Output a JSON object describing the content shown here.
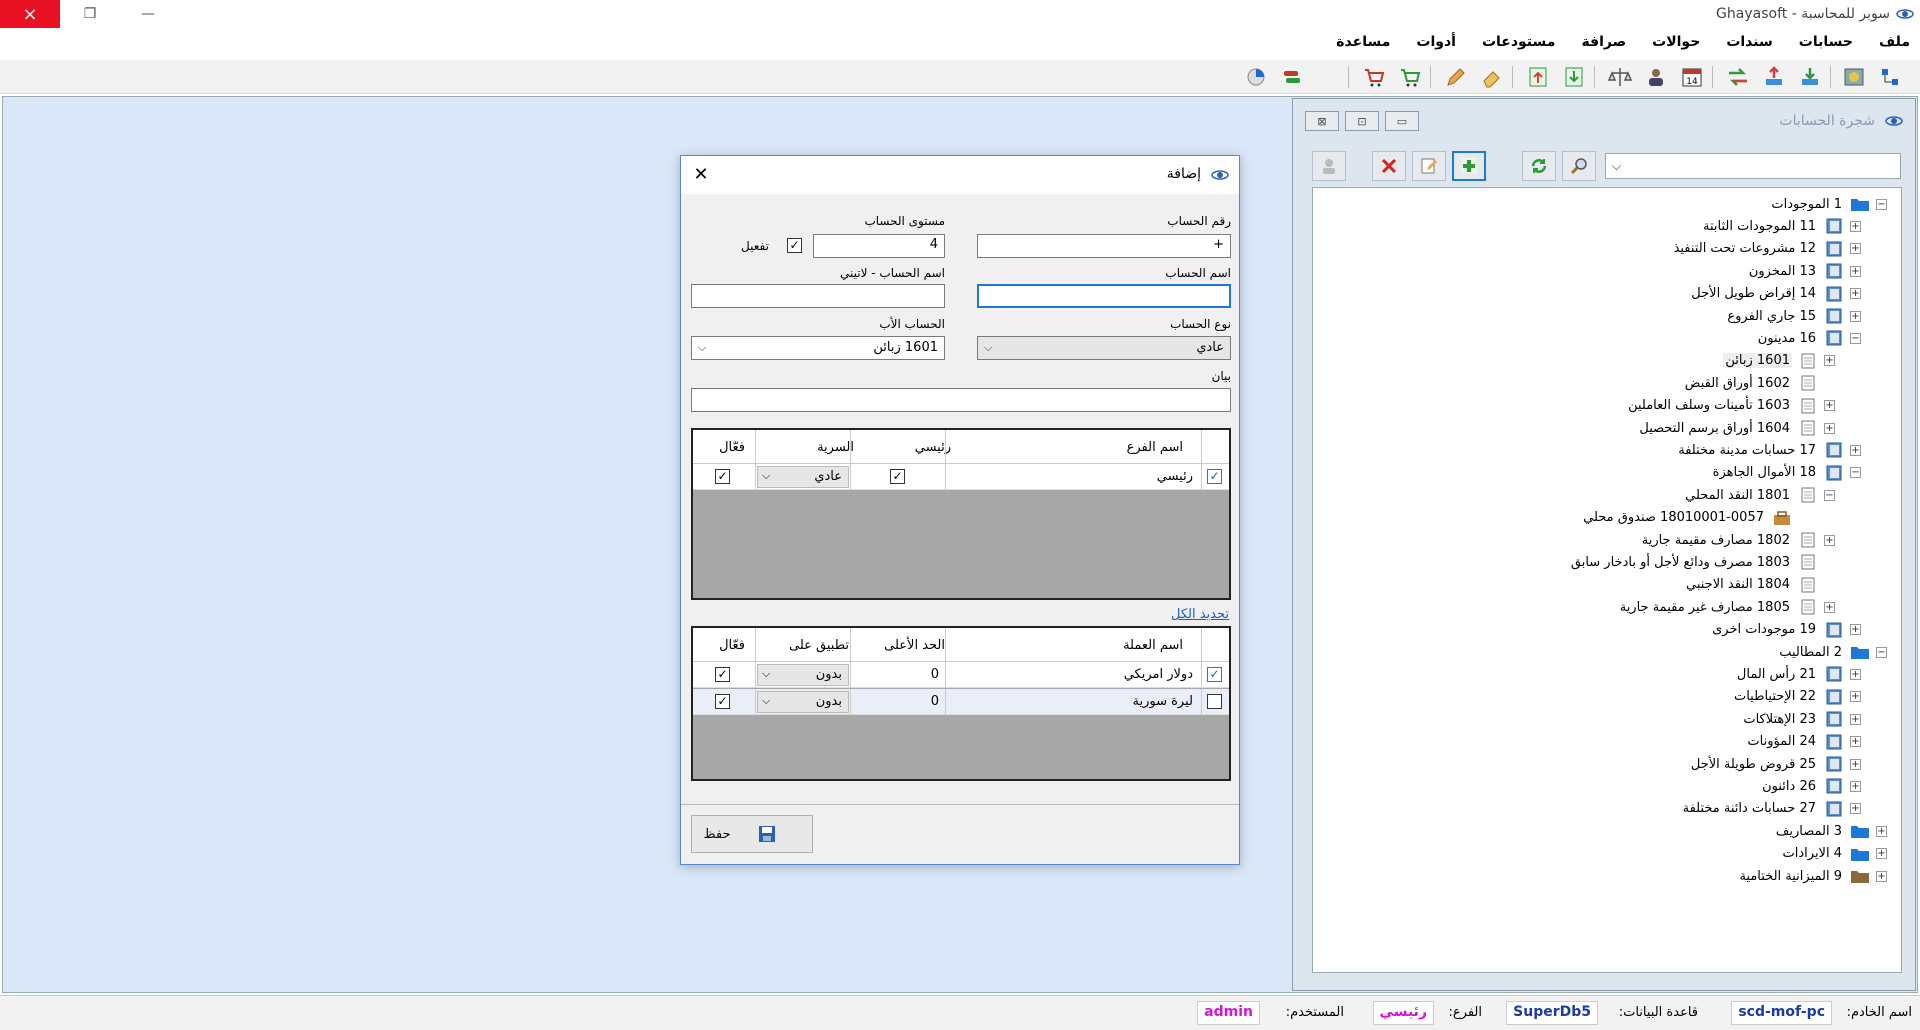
{
  "window": {
    "title": "سوبر للمحاسبة - Ghayasoft",
    "close_icon": "×",
    "restore_icon": "❐",
    "min_icon": "—"
  },
  "menu": [
    "ملف",
    "حسابات",
    "سندات",
    "حوالات",
    "صرافة",
    "مستودعات",
    "أدوات",
    "مساعدة"
  ],
  "toolbar_icons": [
    "tree-icon",
    "map-icon",
    "import-icon",
    "export-icon",
    "transfer-icon",
    "calendar-icon",
    "user-icon",
    "balance-icon",
    "download-icon",
    "upload-icon",
    "eraser-icon",
    "pencil-icon",
    "cart-icon",
    "cart-red-icon",
    "exchange-icon",
    "pie-icon"
  ],
  "tree_panel": {
    "title": "شجرة الحسابات",
    "win_buttons": [
      "⊠",
      "⊡",
      "▭"
    ],
    "combo_value": "",
    "nodes": [
      {
        "level": 0,
        "label": "1 الموجودات",
        "icon": "folder-blue-icon",
        "expander": "−"
      },
      {
        "level": 1,
        "label": "11 الموجودات الثابتة",
        "icon": "ledger-icon",
        "expander": "+"
      },
      {
        "level": 1,
        "label": "12 مشروعات تحت التنفيذ",
        "icon": "ledger-icon",
        "expander": "+"
      },
      {
        "level": 1,
        "label": "13 المخزون",
        "icon": "ledger-icon",
        "expander": "+"
      },
      {
        "level": 1,
        "label": "14 إقراض طويل الأجل",
        "icon": "ledger-icon",
        "expander": "+"
      },
      {
        "level": 1,
        "label": "15 جاري الفروع",
        "icon": "ledger-icon",
        "expander": "+"
      },
      {
        "level": 1,
        "label": "16 مدينون",
        "icon": "ledger-icon",
        "expander": "−"
      },
      {
        "level": 2,
        "label": "1601 زبائن",
        "icon": "page-icon",
        "expander": "+",
        "selected": true
      },
      {
        "level": 2,
        "label": "1602 أوراق القبض",
        "icon": "page-icon",
        "expander": ""
      },
      {
        "level": 2,
        "label": "1603 تأمينات وسلف العاملين",
        "icon": "page-icon",
        "expander": "+"
      },
      {
        "level": 2,
        "label": "1604 أوراق  برسم التحصيل",
        "icon": "page-icon",
        "expander": "+"
      },
      {
        "level": 1,
        "label": "17 حسابات مدينة مختلفة",
        "icon": "ledger-icon",
        "expander": "+"
      },
      {
        "level": 1,
        "label": "18 الأموال الجاهزة",
        "icon": "ledger-icon",
        "expander": "−"
      },
      {
        "level": 2,
        "label": "1801 النقد المحلي",
        "icon": "page-icon",
        "expander": "−"
      },
      {
        "level": 3,
        "label": "18010001-0057 صندوق محلي",
        "icon": "cashbox-icon",
        "expander": ""
      },
      {
        "level": 2,
        "label": "1802 مصارف مقيمة جارية",
        "icon": "page-icon",
        "expander": "+"
      },
      {
        "level": 2,
        "label": "1803 مصرف ودائع لأجل أو بادخار سابق",
        "icon": "page-icon",
        "expander": ""
      },
      {
        "level": 2,
        "label": "1804 النقد الاجنبي",
        "icon": "page-icon",
        "expander": ""
      },
      {
        "level": 2,
        "label": "1805 مصارف غير مقيمة جارية",
        "icon": "page-icon",
        "expander": "+"
      },
      {
        "level": 1,
        "label": "19 موجودات اخرى",
        "icon": "ledger-icon",
        "expander": "+"
      },
      {
        "level": 0,
        "label": "2 المطاليب",
        "icon": "folder-blue-icon",
        "expander": "−"
      },
      {
        "level": 1,
        "label": "21 رأس المال",
        "icon": "ledger-icon",
        "expander": "+"
      },
      {
        "level": 1,
        "label": "22 الإحتياطيات",
        "icon": "ledger-icon",
        "expander": "+"
      },
      {
        "level": 1,
        "label": "23 الإهتلاكات",
        "icon": "ledger-icon",
        "expander": "+"
      },
      {
        "level": 1,
        "label": "24 المؤونات",
        "icon": "ledger-icon",
        "expander": "+"
      },
      {
        "level": 1,
        "label": "25 قروض طويلة الأجل",
        "icon": "ledger-icon",
        "expander": "+"
      },
      {
        "level": 1,
        "label": "26 دائنون",
        "icon": "ledger-icon",
        "expander": "+"
      },
      {
        "level": 1,
        "label": "27 حسابات دائنة مختلفة",
        "icon": "ledger-icon",
        "expander": "+"
      },
      {
        "level": 0,
        "label": "3 المصاريف",
        "icon": "folder-blue-icon",
        "expander": "+"
      },
      {
        "level": 0,
        "label": "4 الايرادات",
        "icon": "folder-blue-icon",
        "expander": "+"
      },
      {
        "level": 0,
        "label": "9 الميزانية الختامية",
        "icon": "folder-brown-icon",
        "expander": "+"
      }
    ]
  },
  "dialog": {
    "title": "إضافة",
    "close_icon": "✕",
    "account_number_label": "رقم الحساب",
    "account_number_value": "+",
    "account_level_label": "مستوى الحساب",
    "account_level_value": "4",
    "activate_label": "تفعيل",
    "activate_check": "✓",
    "account_name_label": "اسم الحساب",
    "account_name_value": "",
    "account_name_latin_label": "اسم الحساب - لاتيني",
    "account_name_latin_value": "",
    "account_type_label": "نوع الحساب",
    "account_type_value": "عادي",
    "parent_account_label": "الحساب الأب",
    "parent_account_value": "1601 زبائن",
    "statement_label": "بيان",
    "statement_value": "",
    "chevron": "⌵",
    "branches_grid": {
      "headers": {
        "name": "اسم الفرع",
        "main": "رئيسي",
        "secrecy": "السرية",
        "active": "فعّال"
      },
      "rows": [
        {
          "name": "رئيسي",
          "selected_check": "✓",
          "main_check": "✓",
          "secrecy": "عادي",
          "active_check": "✓"
        }
      ]
    },
    "select_all": "تحديد الكل",
    "currencies_grid": {
      "headers": {
        "name": "اسم العملة",
        "max": "الحد الأعلى",
        "apply": "تطبيق على",
        "active": "فعّال"
      },
      "rows": [
        {
          "name": "دولار امريكي",
          "selected_check": "✓",
          "max": "0",
          "apply": "بدون",
          "active_check": "✓"
        },
        {
          "name": "ليرة سورية",
          "selected_check": "",
          "max": "0",
          "apply": "بدون",
          "active_check": "✓"
        }
      ]
    },
    "save_label": "حفظ"
  },
  "status": {
    "server_label": "اسم الخادم:",
    "server_value": "scd-mof-pc",
    "db_label": "قاعدة البيانات:",
    "db_value": "SuperDb5",
    "branch_label": "الفرع:",
    "branch_value": "رئيسي",
    "user_label": "المستخدم:",
    "user_value": "admin"
  },
  "colors": {
    "accent": "#1e78d6",
    "close_red": "#e81123",
    "status_blue": "#1a3aa8",
    "status_magenta": "#d415d4",
    "workspace": "#d9e7f8"
  }
}
